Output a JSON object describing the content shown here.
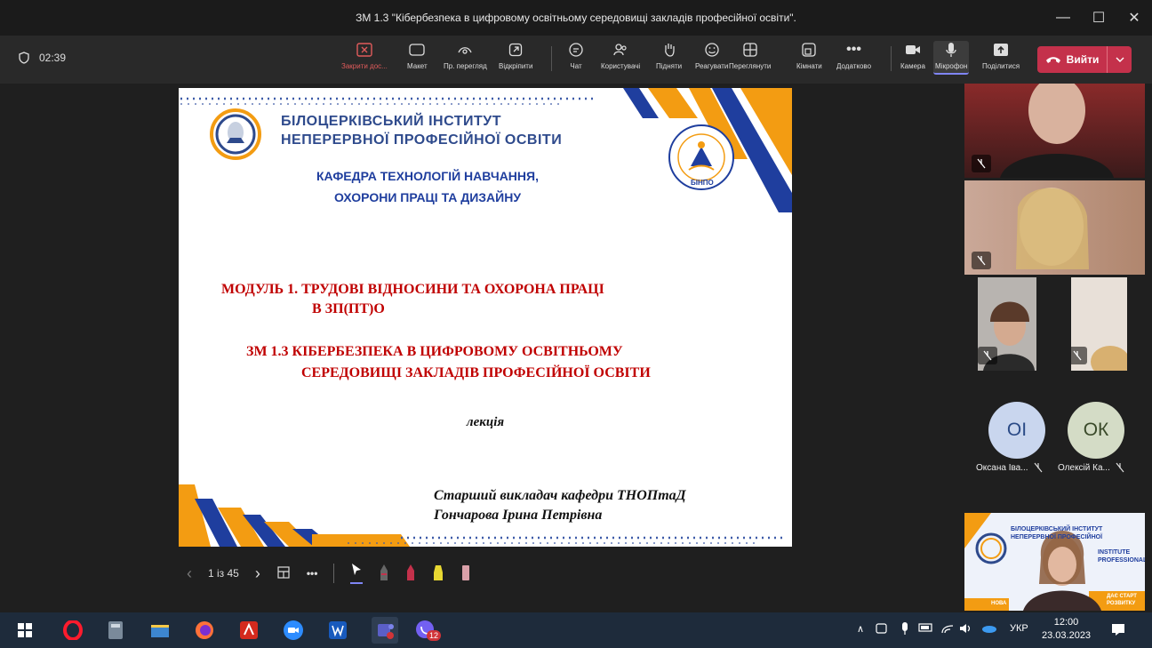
{
  "window": {
    "title": "ЗМ 1.3 \"Кібербезпека в цифровому освітньому середовищі закладів професійної освіти\".",
    "controls": [
      "—",
      "☐",
      "✕"
    ]
  },
  "meeting": {
    "timer": "02:39",
    "toolbar": {
      "stop_sharing": "Закрити дос...",
      "layout": "Макет",
      "presenter_view": "Пр. перегляд",
      "pop_out": "Відкріпити",
      "chat": "Чат",
      "people": "Користувачі",
      "raise": "Підняти",
      "react": "Реагувати",
      "view": "Переглянути",
      "rooms": "Кімнати",
      "more": "Додатково",
      "camera": "Камера",
      "mic": "Мікрофон",
      "share": "Поділитися",
      "leave": "Вийти"
    }
  },
  "slide": {
    "institute_line1": "БІЛОЦЕРКІВСЬКИЙ  ІНСТИТУТ",
    "institute_line2": "НЕПЕРЕРВНОЇ ПРОФЕСІЙНОЇ ОСВІТИ",
    "dept_line1": "КАФЕДРА ТЕХНОЛОГІЙ НАВЧАННЯ,",
    "dept_line2": "ОХОРОНИ ПРАЦІ ТА ДИЗАЙНУ",
    "logo_label": "БІНПО",
    "module_line1": "МОДУЛЬ 1.  ТРУДОВІ ВІДНОСИНИ ТА ОХОРОНА ПРАЦІ",
    "module_line2": "В ЗП(ПТ)О",
    "topic_line1": "ЗМ 1.3 КІБЕРБЕЗПЕКА В ЦИФРОВОМУ ОСВІТНЬОМУ",
    "topic_line2": "СЕРЕДОВИЩІ ЗАКЛАДІВ ПРОФЕСІЙНОЇ ОСВІТИ",
    "lecture": "лекція",
    "author_line1": "Старший викладач кафедри ТНОПтаД",
    "author_line2": "Гончарова Ірина Петрівна",
    "page_indicator": "1 із 45"
  },
  "participants": {
    "p1_initials": "ОІ",
    "p1_name": "Оксана Іва...",
    "p2_initials": "ОК",
    "p2_name": "Олексій Ка..."
  },
  "shared_tile": {
    "line1": "БІЛОЦЕРКІВСЬКИЙ ІНСТИТУТ",
    "line2": "НЕПЕРЕРВНОЇ ПРОФЕСІЙНОЇ",
    "line3": "INSTITUTE",
    "line4": "PROFESSIONAL",
    "line5": "ДАЄ СТАРТ",
    "line6": "РОЗВИТКУ",
    "line7": "НОВА"
  },
  "taskbar": {
    "teams_badge": "12",
    "language": "УКР",
    "time": "12:00",
    "date": "23.03.2023"
  }
}
